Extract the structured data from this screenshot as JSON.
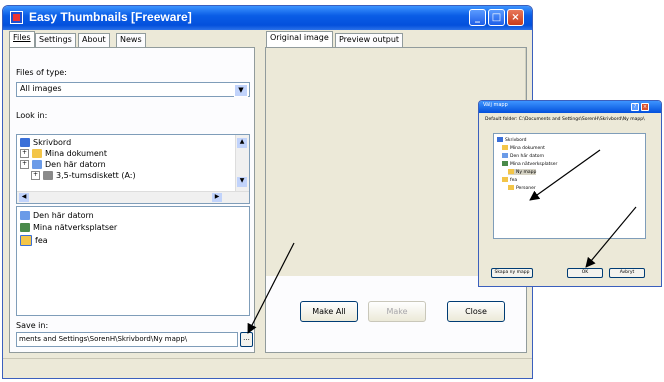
{
  "window": {
    "title": "Easy Thumbnails [Freeware]",
    "caption_buttons": {
      "minimize": "_",
      "maximize": "□",
      "close": "×"
    }
  },
  "left_tabs": [
    {
      "label": "Files",
      "selected": true
    },
    {
      "label": "Settings",
      "selected": false
    },
    {
      "label": "About",
      "selected": false
    },
    {
      "label": "News",
      "selected": false
    }
  ],
  "right_tabs": [
    {
      "label": "Original image",
      "selected": true
    },
    {
      "label": "Preview output",
      "selected": false
    }
  ],
  "files": {
    "type_label": "Files of type:",
    "type_value": "All images",
    "look_in_label": "Look in:",
    "tree": [
      {
        "label": "Skrivbord",
        "icon": "desktop-icon"
      },
      {
        "label": "Mina dokument",
        "icon": "folder-icon"
      },
      {
        "label": "Den här datorn",
        "icon": "computer-icon"
      },
      {
        "label": "3,5-tumsdiskett (A:)",
        "icon": "floppy-icon"
      }
    ],
    "list": [
      {
        "label": "Den här datorn",
        "icon": "computer-icon"
      },
      {
        "label": "Mina nätverksplatser",
        "icon": "network-icon"
      },
      {
        "label": "fea",
        "icon": "image-folder-icon"
      }
    ],
    "save_label": "Save in:",
    "save_value": "ments and Settings\\SorenH\\Skrivbord\\Ny mapp\\",
    "browse_label": "..."
  },
  "actions": {
    "make_all": "Make All",
    "make": "Make",
    "close": "Close"
  },
  "dialog": {
    "title": "Välj mapp",
    "description": "Default folder: C:\\Documents and Settings\\SorenH\\Skrivbord\\Ny mapp\\",
    "tree": [
      "Skrivbord",
      "Mina dokument",
      "Den här datorn",
      "Mina nätverksplatser",
      "Ny mapp",
      "fea",
      "Personer"
    ],
    "buttons": {
      "new_folder": "Skapa ny mapp",
      "ok": "OK",
      "cancel": "Avbryt"
    }
  },
  "colors": {
    "titlebar": "#0a5de6",
    "window_bg": "#ece9d8",
    "arrow": "#000000"
  }
}
